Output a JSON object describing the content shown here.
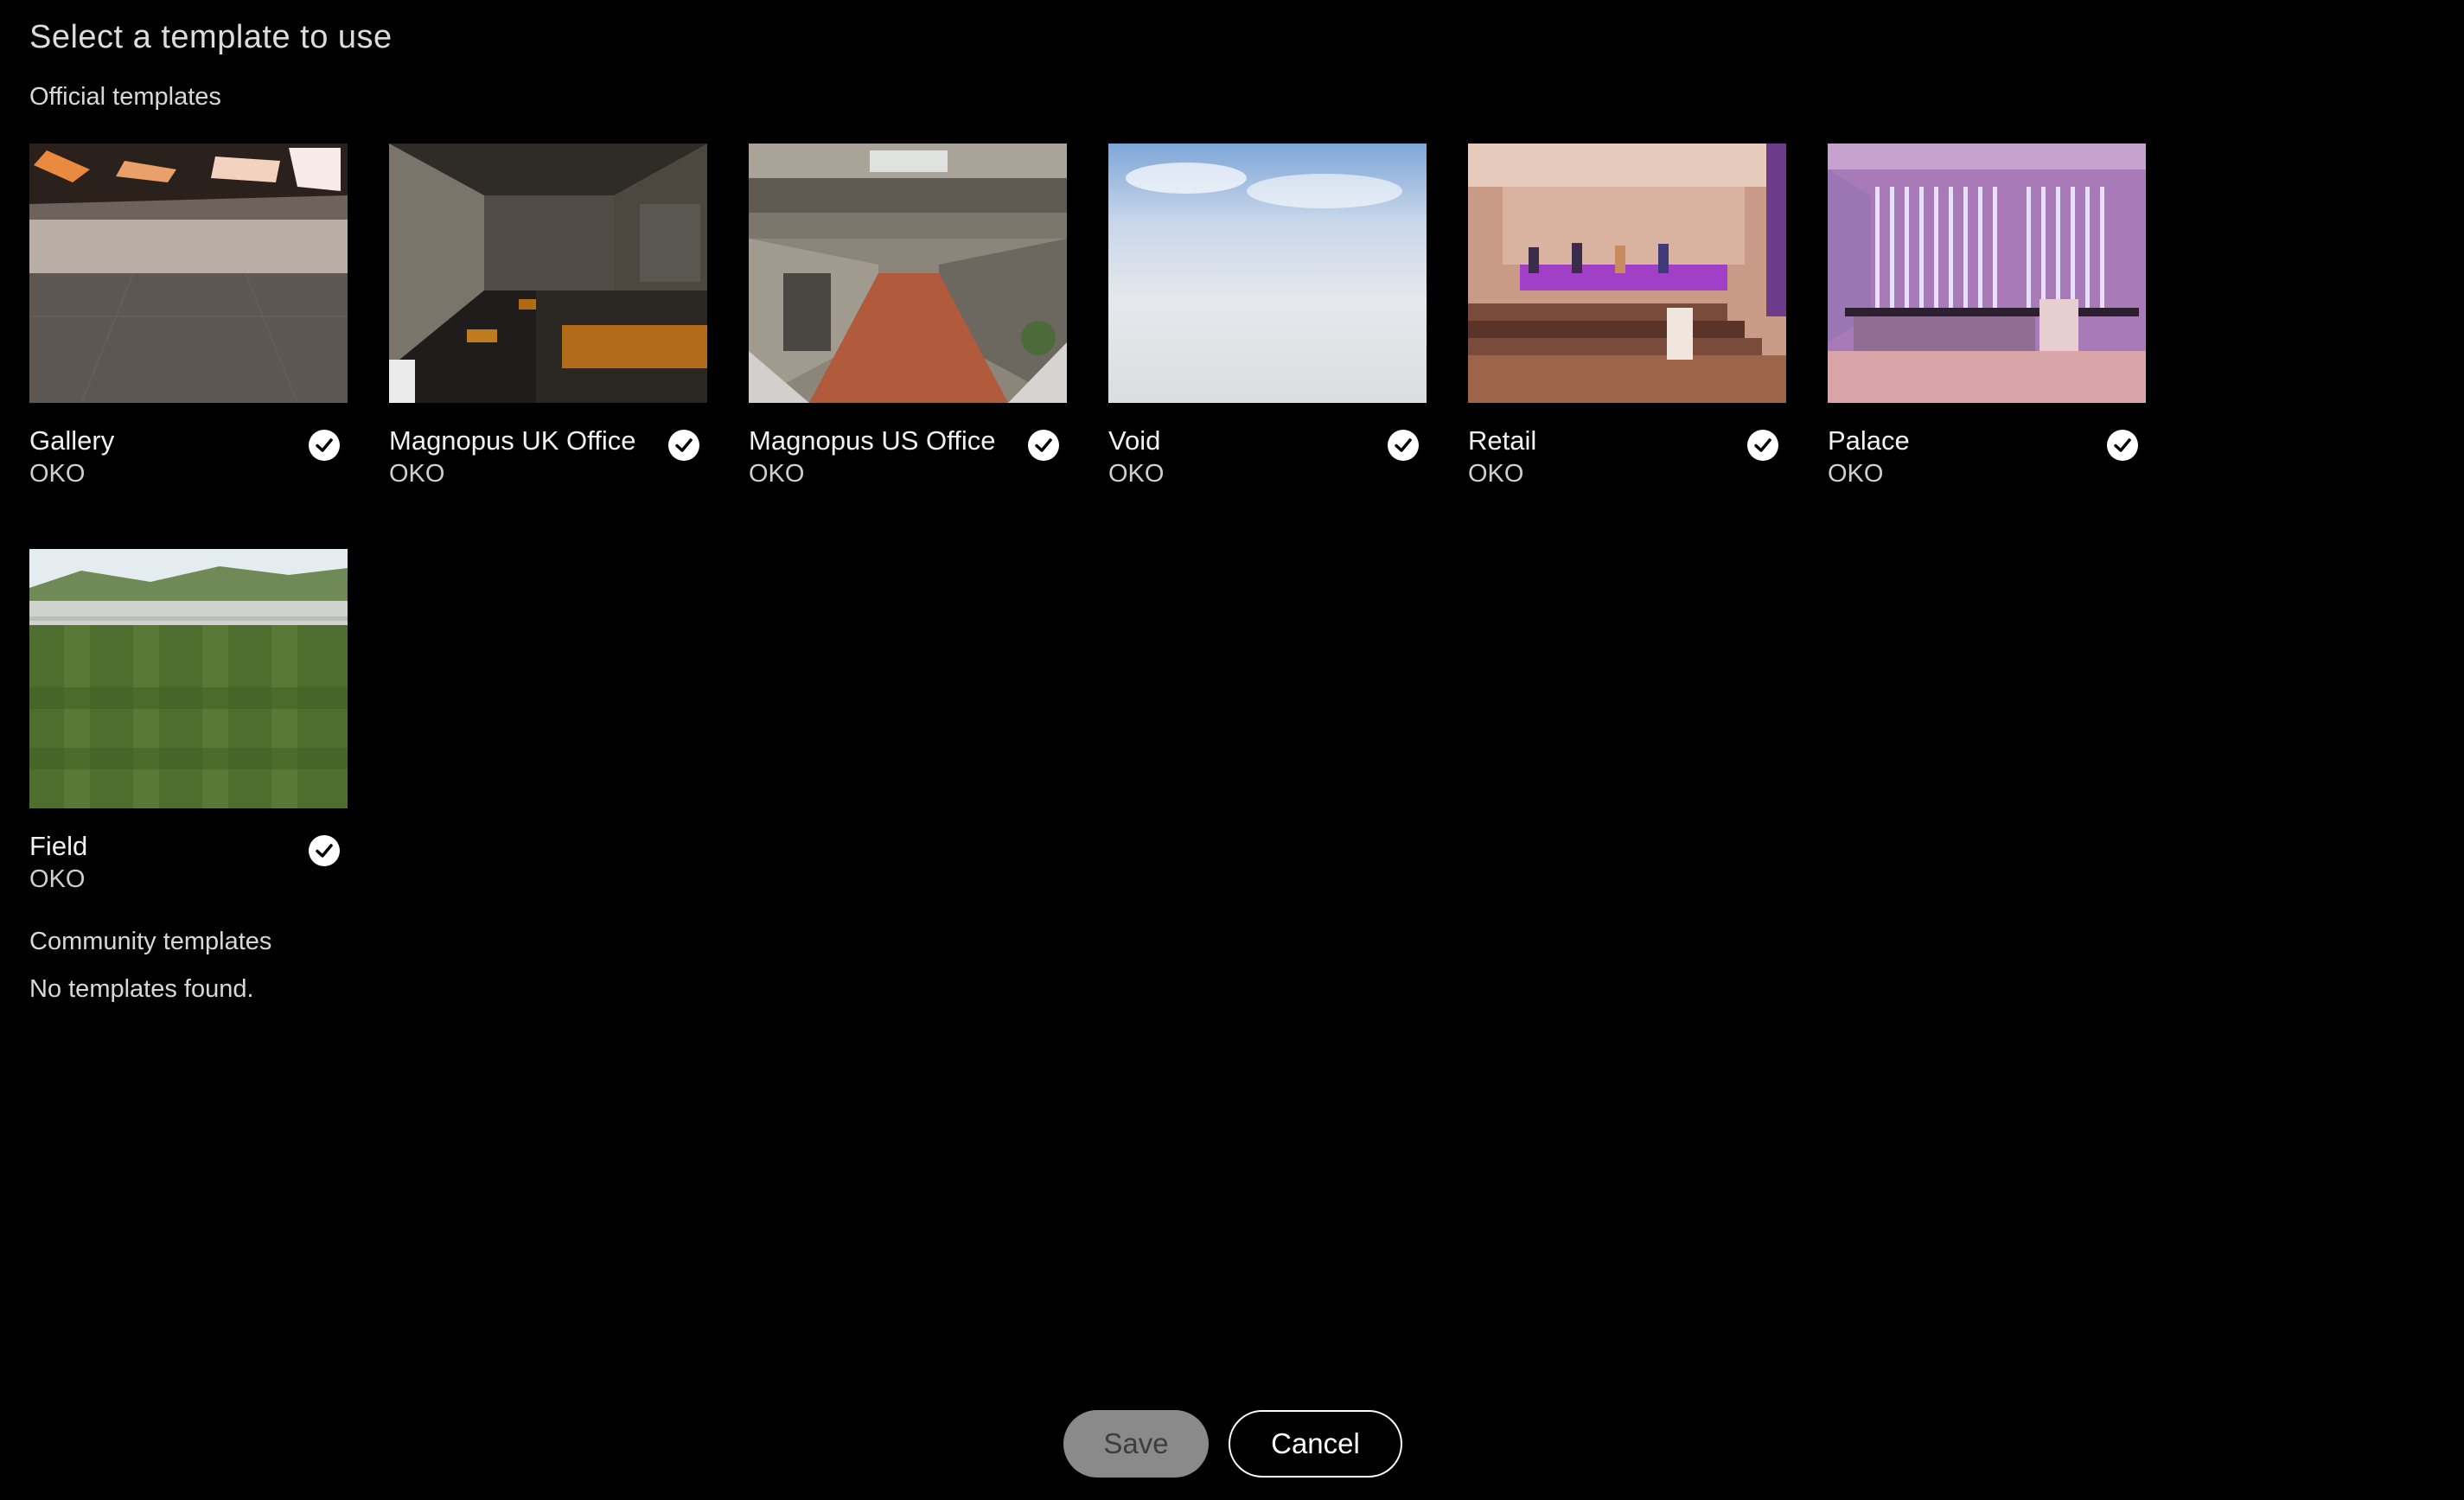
{
  "title": "Select a template to use",
  "official": {
    "label": "Official templates",
    "templates": [
      {
        "name": "Gallery",
        "author": "OKO",
        "verified": true
      },
      {
        "name": "Magnopus UK Office",
        "author": "OKO",
        "verified": true
      },
      {
        "name": "Magnopus US Office",
        "author": "OKO",
        "verified": true
      },
      {
        "name": "Void",
        "author": "OKO",
        "verified": true
      },
      {
        "name": "Retail",
        "author": "OKO",
        "verified": true
      },
      {
        "name": "Palace",
        "author": "OKO",
        "verified": true
      },
      {
        "name": "Field",
        "author": "OKO",
        "verified": true
      }
    ]
  },
  "community": {
    "label": "Community templates",
    "empty_message": "No templates found."
  },
  "footer": {
    "save_label": "Save",
    "cancel_label": "Cancel"
  },
  "icons": {
    "verified": "verified-badge-icon"
  },
  "colors": {
    "background": "#000000",
    "save_disabled_bg": "#8a8a8a",
    "text": "#ffffff"
  }
}
